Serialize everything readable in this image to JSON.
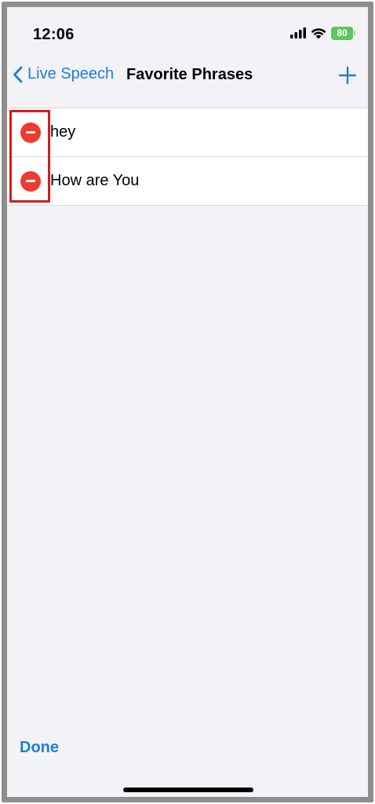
{
  "status_bar": {
    "time": "12:06",
    "battery_level": "80",
    "battery_color": "#5ac85a",
    "icons": [
      "signal-icon",
      "wifi-icon",
      "battery-charging-icon"
    ]
  },
  "nav": {
    "back_label": "Live Speech",
    "title": "Favorite Phrases",
    "add_icon": "plus-icon",
    "accent_color": "#1a7fdc"
  },
  "phrases": [
    {
      "text": "hey"
    },
    {
      "text": "How are You"
    }
  ],
  "delete_icon": "minus-circle-icon",
  "delete_color": "#f03a2e",
  "highlight_color": "#d61b1b",
  "toolbar": {
    "done_label": "Done"
  }
}
